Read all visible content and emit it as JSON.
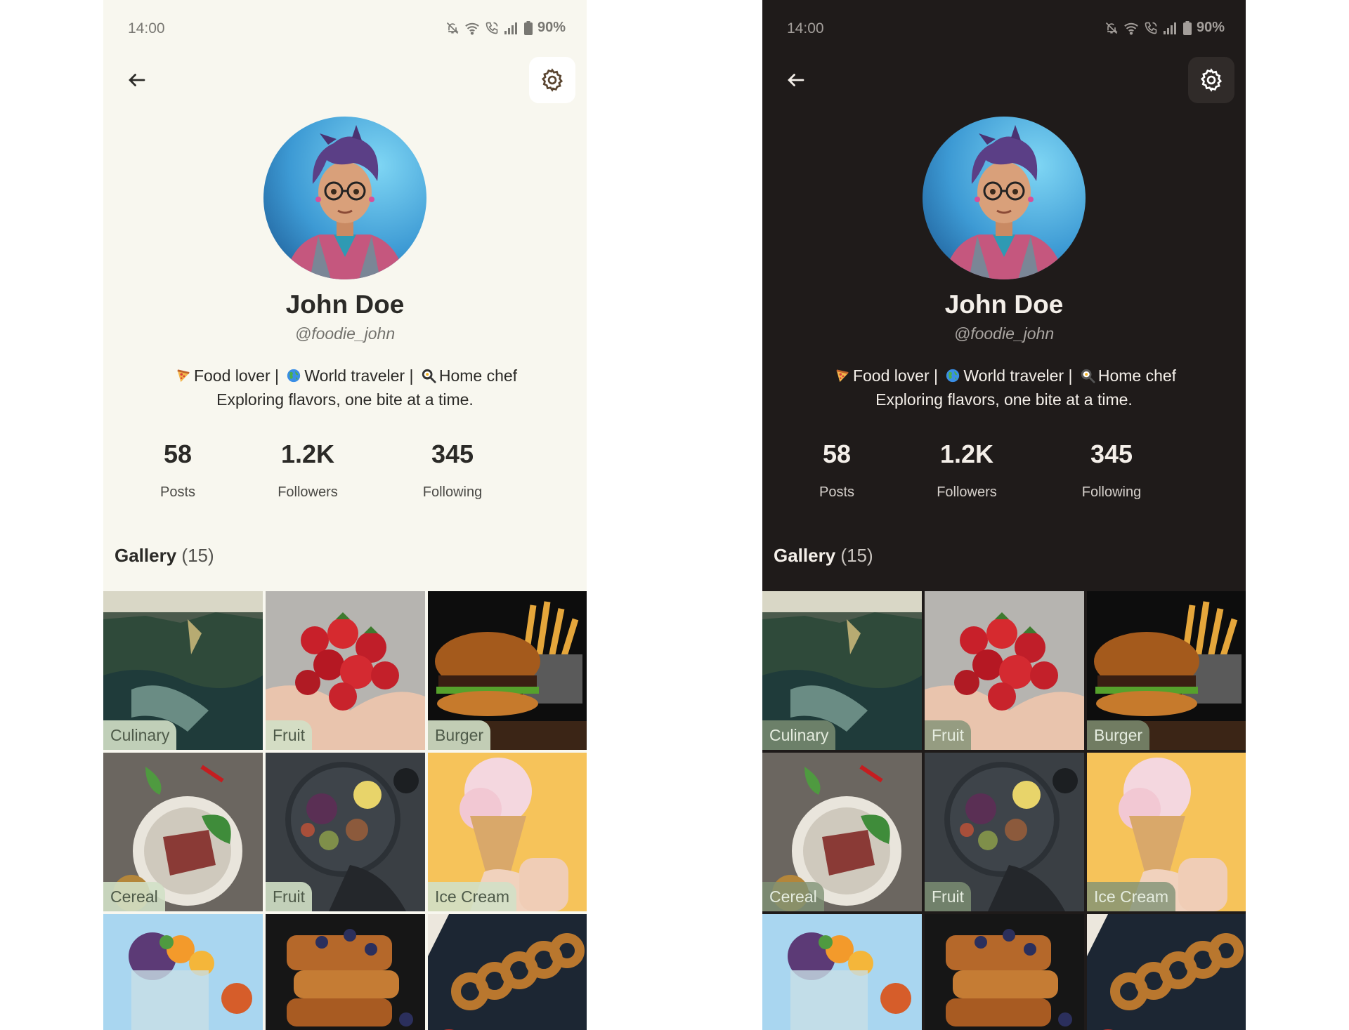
{
  "status": {
    "time": "14:00",
    "battery": "90%"
  },
  "profile": {
    "name": "John Doe",
    "handle": "@foodie_john",
    "bio_line1": "Food lover | 🌍 World traveler | 🍳 Home chef",
    "bio_line1_parts": [
      "Food lover |",
      "World traveler |",
      "Home chef"
    ],
    "bio_line2": "Exploring flavors, one bite at a time.",
    "bio_emojis": [
      "pizza-icon",
      "globe-icon",
      "cooking-pan-icon"
    ]
  },
  "stats": [
    {
      "value": "58",
      "label": "Posts"
    },
    {
      "value": "1.2K",
      "label": "Followers"
    },
    {
      "value": "345",
      "label": "Following"
    }
  ],
  "gallery": {
    "label": "Gallery",
    "count": "(15)",
    "items": [
      {
        "tag": "Culinary",
        "image": "coastal-cliffs-photo"
      },
      {
        "tag": "Fruit",
        "image": "strawberries-photo"
      },
      {
        "tag": "Burger",
        "image": "burger-fries-photo"
      },
      {
        "tag": "Cereal",
        "image": "steak-plate-photo"
      },
      {
        "tag": "Fruit",
        "image": "figs-platter-photo"
      },
      {
        "tag": "Ice Cream",
        "image": "ice-cream-cone-photo"
      },
      {
        "tag": "",
        "image": "smoothie-bowl-photo"
      },
      {
        "tag": "",
        "image": "french-toast-photo"
      },
      {
        "tag": "",
        "image": "onion-rings-photo"
      }
    ]
  },
  "themes": [
    {
      "name": "light",
      "background": "#f8f7ef",
      "text": "#2b2a27"
    },
    {
      "name": "dark",
      "background": "#1f1b1a",
      "text": "#f4efe9"
    }
  ],
  "accent_colors": {
    "tag_light": "#d2e0c6",
    "tag_dark": "#809276"
  }
}
